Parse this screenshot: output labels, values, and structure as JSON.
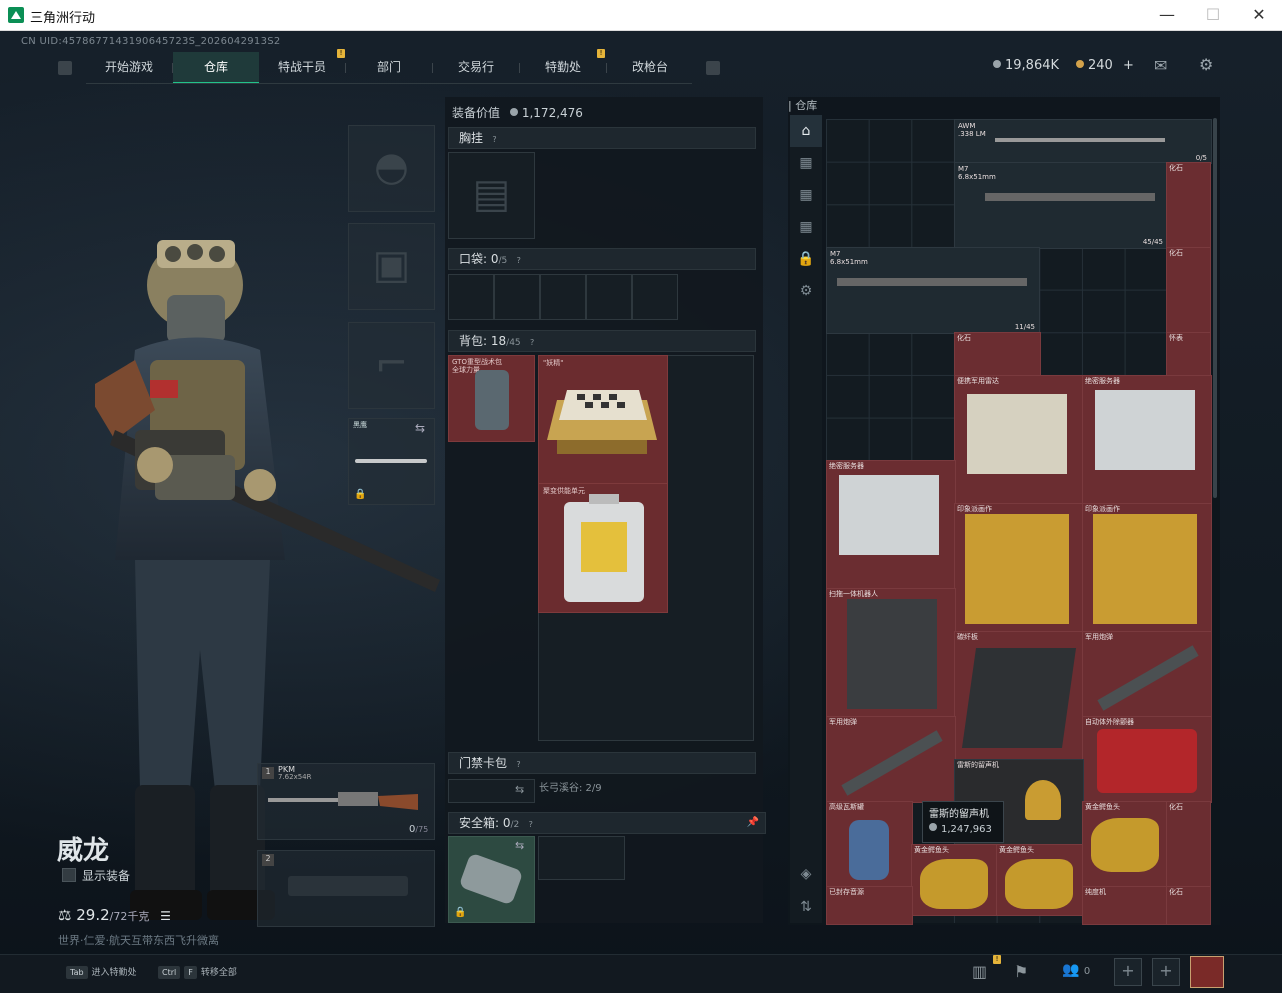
{
  "window": {
    "title": "三角洲行动",
    "minimize": "—",
    "maximize": "☐",
    "close": "✕"
  },
  "uid": "CN UID:4578677143190645723S_2026042913S2",
  "nav": {
    "tabs": [
      {
        "label": "开始游戏"
      },
      {
        "label": "仓库"
      },
      {
        "label": "特战干员"
      },
      {
        "label": "部门"
      },
      {
        "label": "交易行"
      },
      {
        "label": "特勤处"
      },
      {
        "label": "改枪台"
      }
    ],
    "notif_mark": "!"
  },
  "currency": {
    "coins": "19,864K",
    "tickets": "240",
    "plus": "+"
  },
  "character": {
    "name": "威龙",
    "show_equipment": "显示装备",
    "weight": "29.2",
    "weight_max": "/72千克",
    "status": "世界·仁爱·航天互带东西飞升微离",
    "status_hi": "世界·仁爱·"
  },
  "loadout": {
    "melee_label": "黑鹰",
    "primary": {
      "slot": "1",
      "name": "PKM",
      "ammo": "7.62x54R",
      "count": "0",
      "cap": "/75"
    },
    "secondary": {
      "slot": "2"
    }
  },
  "equipment": {
    "value_label": "装备价值",
    "value": "1,172,476",
    "chest": "胸挂",
    "pocket": "口袋:",
    "pocket_count": "0",
    "pocket_cap": "/5",
    "backpack": "背包:",
    "backpack_count": "18",
    "backpack_cap": "/45",
    "bag_item1": "GTO重型战术包",
    "bag_item1b": "全球力量",
    "bag_item2": "\"妖精\"",
    "bag_item3": "聚变供能单元",
    "keycard": "门禁卡包",
    "keycard_info": "长弓溪谷: 2/9",
    "safebox": "安全箱:",
    "safebox_count": "0",
    "safebox_cap": "/2"
  },
  "warehouse": {
    "title": "仓库",
    "items": {
      "awm": "AWM",
      "awm_ammo": ".338 LM",
      "awm_count": "0/5",
      "m7a": "M7",
      "m7a_ammo": "6.8x51mm",
      "m7a_count": "45/45",
      "m7b": "M7",
      "m7b_ammo": "6.8x51mm",
      "m7b_count": "11/45",
      "fossil": "化石",
      "watch": "怀表",
      "radar": "便携军用雷达",
      "server1": "绝密服务器",
      "server2": "绝密服务器",
      "painting1": "印象派画作",
      "painting2": "印象派画作",
      "robot": "扫拖一体机器人",
      "carbon": "碳纤板",
      "missile1": "军用炮弹",
      "missile2": "军用炮弹",
      "defib": "自动体外除颤器",
      "gramophone": "雷斯的留声机",
      "gas": "高级瓦斯罐",
      "gold1": "黄金鳄鱼头",
      "gold2": "黄金鳄鱼头",
      "gold3": "黄金鳄鱼头",
      "tape": "已封存音源",
      "router": "纯度机"
    },
    "tooltip": {
      "name": "雷斯的留声机",
      "price": "1,247,963"
    }
  },
  "bottom": {
    "tab_key": "Tab",
    "tab_label": "进入特勤处",
    "ctrl_key": "Ctrl",
    "f_key": "F",
    "f_label": "转移全部",
    "squad_count": "0",
    "plus": "+"
  },
  "colors": {
    "accent": "#22c28a",
    "item_red": "#6b2c2f",
    "gold": "#e5b43a"
  }
}
